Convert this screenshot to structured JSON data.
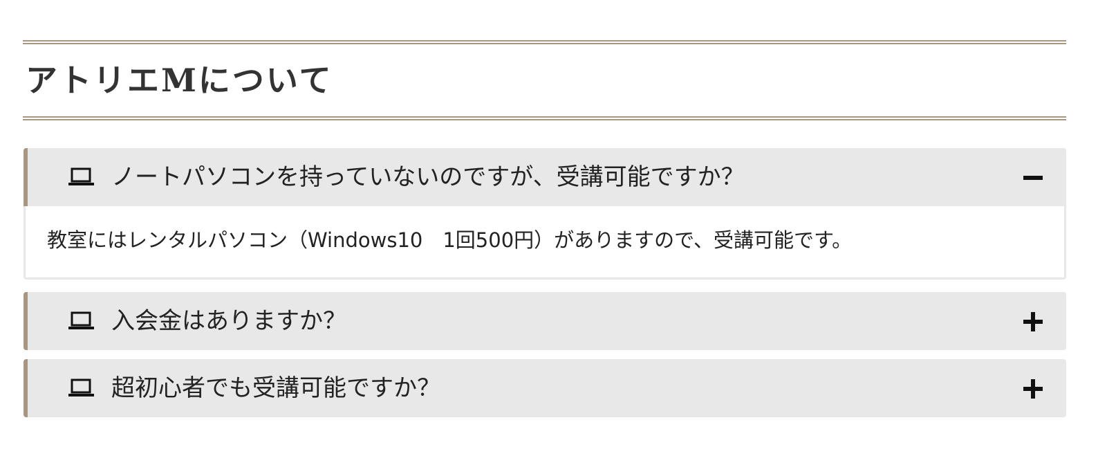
{
  "section": {
    "title": "アトリエMについて"
  },
  "faq": [
    {
      "question": "ノートパソコンを持っていないのですが、受講可能ですか？",
      "answer": "教室にはレンタルパソコン（Windows10　1回500円）がありますので、受講可能です。",
      "expanded": true,
      "icon": "laptop-icon",
      "toggle_icon": "minus-icon"
    },
    {
      "question": "入会金はありますか？",
      "expanded": false,
      "icon": "laptop-icon",
      "toggle_icon": "plus-icon"
    },
    {
      "question": "超初心者でも受講可能ですか？",
      "expanded": false,
      "icon": "laptop-icon",
      "toggle_icon": "plus-icon"
    }
  ],
  "colors": {
    "accent": "#a89682",
    "header_bg": "#e8e8e8",
    "text": "#222222"
  }
}
